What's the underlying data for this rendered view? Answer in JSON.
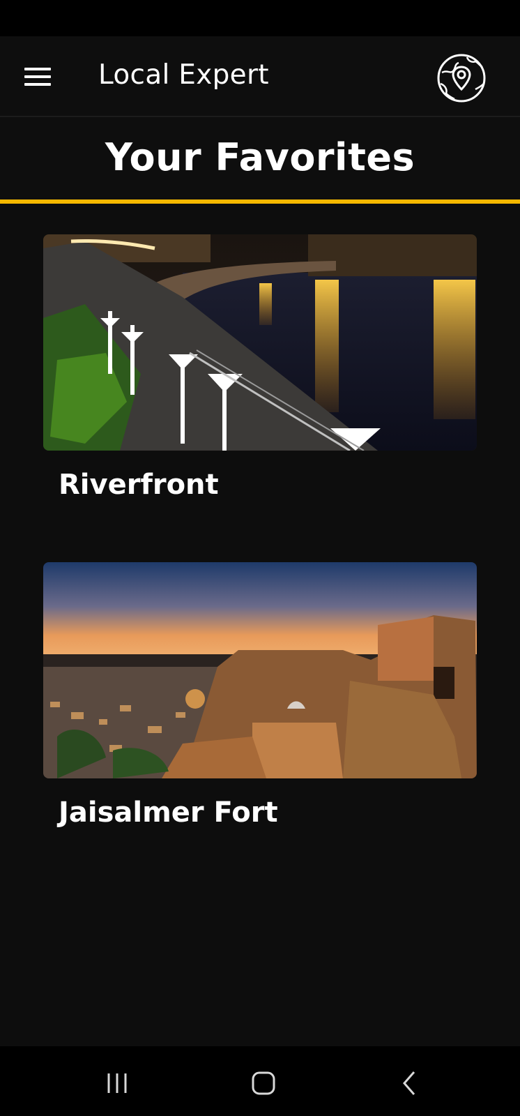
{
  "app_bar": {
    "title": "Local Expert",
    "menu_icon": "hamburger-menu-icon",
    "right_icon": "globe-location-pin-icon"
  },
  "page": {
    "title": "Your Favorites",
    "accent_color": "#f5b800"
  },
  "favorites": [
    {
      "name": "Riverfront",
      "image": "riverfront-night-photo"
    },
    {
      "name": "Jaisalmer Fort",
      "image": "jaisalmer-fort-dusk-photo"
    }
  ],
  "nav_bar": {
    "recents_icon": "recent-apps-icon",
    "home_icon": "home-icon",
    "back_icon": "back-icon"
  }
}
